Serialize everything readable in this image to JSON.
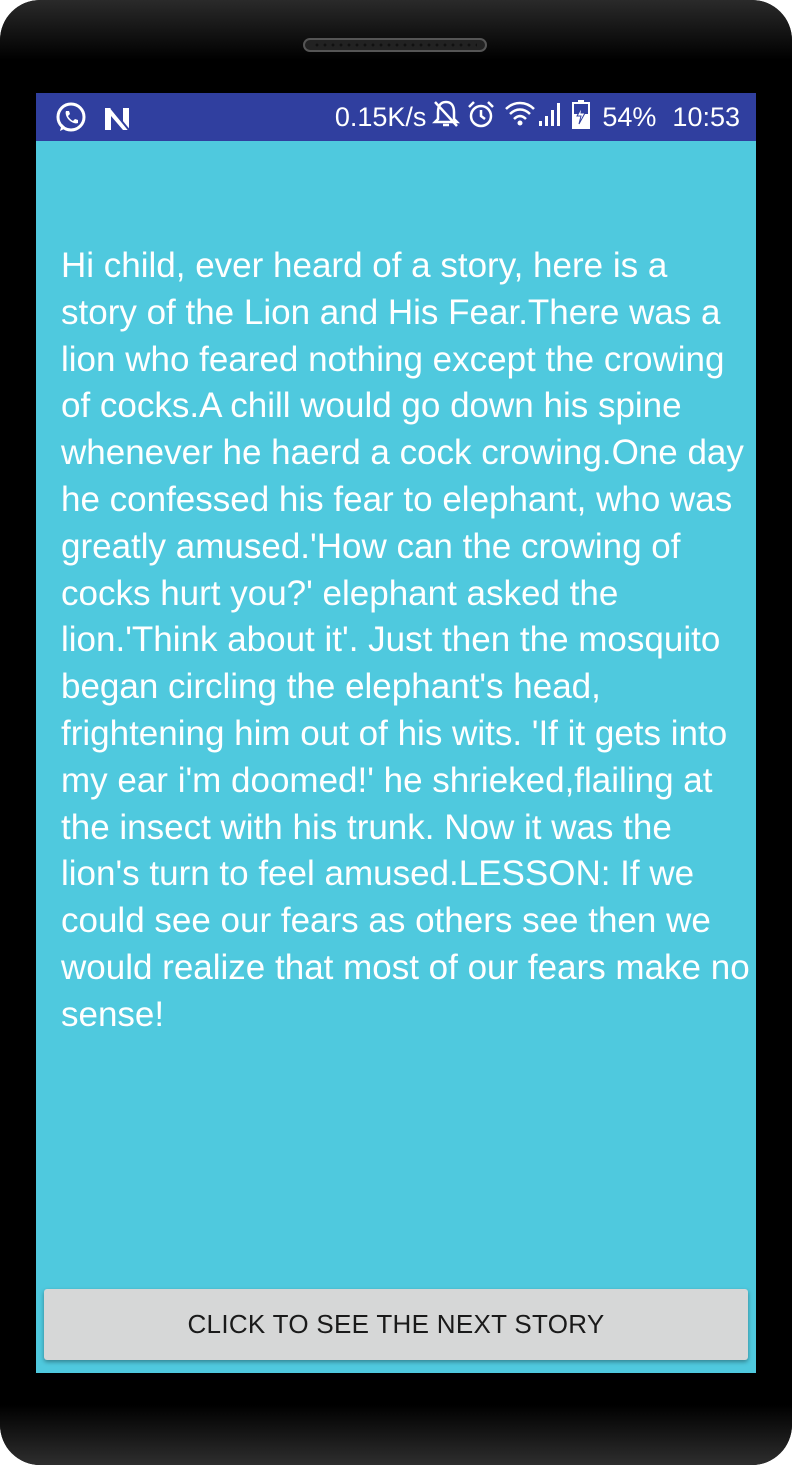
{
  "status_bar": {
    "left_icons": [
      "whatsapp-icon",
      "n-notification-icon"
    ],
    "net_speed": "0.15K/s",
    "right_icons": [
      "notifications-off-icon",
      "alarm-icon",
      "wifi-icon",
      "signal-icon",
      "battery-charging-icon"
    ],
    "battery": "54%",
    "time": "10:53"
  },
  "story": {
    "text": "Hi child, ever heard of a story, here is a story of the Lion and His Fear.There was a lion who feared nothing except the crowing of cocks.A chill would go down his spine whenever he haerd a cock crowing.One day he confessed his fear to elephant, who was greatly amused.'How can the crowing of cocks hurt you?' elephant asked the lion.'Think about it'. Just then the mosquito began circling the elephant's head, frightening him out of his wits. 'If it gets into my ear i'm doomed!' he shrieked,flailing at the insect with his trunk. Now it was the lion's turn to feel amused.LESSON: If we could see our fears as others see then we would realize that most of our fears make no sense!"
  },
  "next_button": {
    "label": "CLICK TO SEE THE NEXT STORY"
  },
  "colors": {
    "status_bar": "#303f9f",
    "background": "#4fc9de",
    "button": "#d6d7d7",
    "text": "#ffffff"
  }
}
